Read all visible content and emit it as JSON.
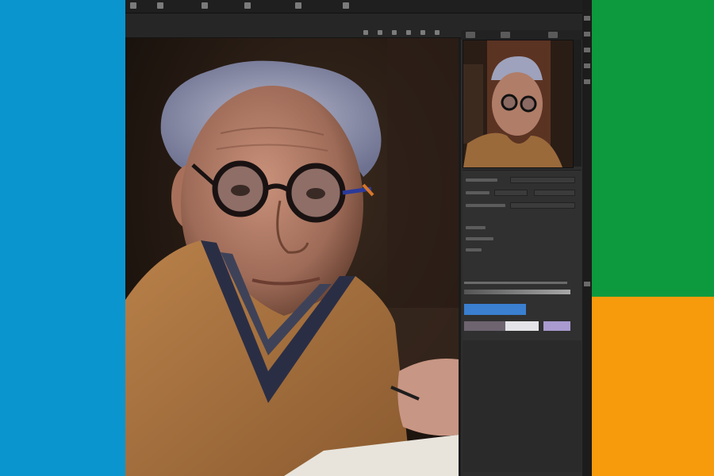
{
  "background": {
    "left_color": "#0a95cf",
    "right_top_color": "#0d9a3e",
    "right_bottom_color": "#f79a0c"
  },
  "app": {
    "toolbar_icons": [
      "menu-icon",
      "tool-icon",
      "brush-icon",
      "adjust-icon",
      "view-icon",
      "help-icon"
    ],
    "options_icons": [
      "align-icon",
      "transform-icon",
      "arrange-icon"
    ],
    "panel": {
      "tabs": [
        "navigator-tab",
        "layers-tab",
        "properties-tab"
      ],
      "swatches": {
        "accent_blue": "#3a7fd0",
        "gray": "#6d6470",
        "white": "#e4e4e8",
        "lilac": "#a99ad0"
      }
    },
    "canvas_subject": "portrait-painting"
  }
}
